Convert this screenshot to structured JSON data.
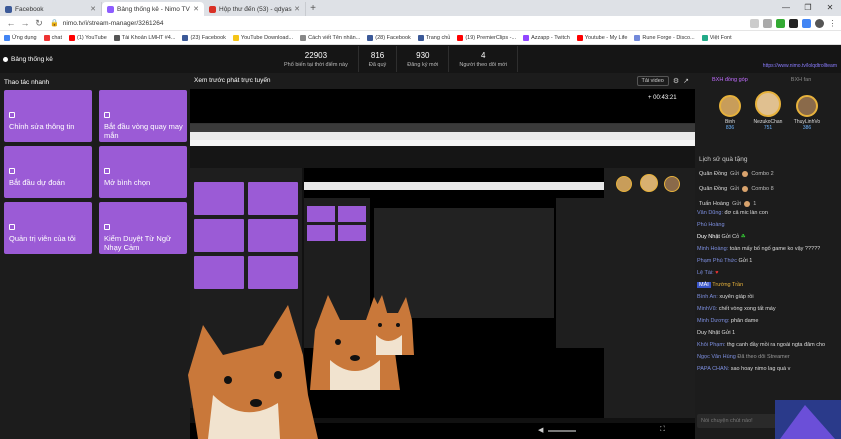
{
  "browser": {
    "tabs": [
      {
        "label": "Facebook",
        "color": "#3b5998",
        "active": false
      },
      {
        "label": "Bảng thống kê - Nimo TV",
        "color": "#8d5cff",
        "active": true
      },
      {
        "label": "Hộp thư đến (53) - qdyasus123...",
        "color": "#d93025",
        "active": false
      }
    ],
    "new_tab": "+",
    "url": "nimo.tv/i/stream-manager/3261264",
    "bookmarks": [
      "Ứng dụng",
      "chat",
      "(1) YouTube",
      "Tài Khoản LMHT #4...",
      "(23) Facebook",
      "YouTube Download...",
      "Cách viết Tên nhân...",
      "(28) Facebook",
      "Trang chủ",
      "(19) PremierClips -...",
      "Azzapp - Twitch",
      "Youtube - My Life",
      "Rune Forge - Disco...",
      "Việt Font"
    ]
  },
  "header": {
    "title": "Bảng thống kê",
    "stats": [
      {
        "value": "22903",
        "label": "Phổ biến tại thời điểm này"
      },
      {
        "value": "816",
        "label": "Đã quý"
      },
      {
        "value": "930",
        "label": "Đăng ký mới"
      },
      {
        "value": "4",
        "label": "Người theo dõi mới"
      }
    ],
    "link": "https://www.nimo.tv/lolqdtrollteam"
  },
  "left": {
    "heading": "Thao tác nhanh",
    "tiles": [
      "Chỉnh sửa thông tin",
      "Bắt đầu vòng quay may mắn",
      "Bắt đầu dự đoán",
      "Mở bình chọn",
      "Quản trị viên của tôi",
      "Kiểm Duyệt Từ Ngữ Nhạy Cảm"
    ]
  },
  "preview": {
    "heading": "Xem trước phát trực tuyến",
    "button": "Tải video",
    "timer": "+ 00:43:21"
  },
  "right": {
    "tab_active": "BXH đồng góp",
    "tab_other": "BXH fan",
    "ranks": [
      {
        "name": "Binh",
        "score": "836"
      },
      {
        "name": "NezukoChan",
        "score": "751"
      },
      {
        "name": "ThuyLinhVo",
        "score": "386"
      }
    ],
    "gift_heading": "Lịch sử quà tặng",
    "gifts": [
      {
        "name": "Quân Đồng",
        "verb": "Gửi",
        "combo": "Combo 2"
      },
      {
        "name": "Quân Đồng",
        "verb": "Gửi",
        "combo": "Combo 8"
      },
      {
        "name": "Tuấn Hoàng",
        "verb": "Gửi",
        "combo": "1"
      }
    ],
    "chat": [
      {
        "user": "Văn Dũng:",
        "text": "đơ cả mic làn con"
      },
      {
        "user": "Phú Hoàng",
        "text": ""
      },
      {
        "user": "Duy Nhật",
        "text": "Gửi Cỏ"
      },
      {
        "user": "Minh Hoàng:",
        "text": "toàn mấy bố ngố game ko vậy ?????"
      },
      {
        "user": "Phạm Phú Thức",
        "text": "Gửi 1"
      },
      {
        "user": "Lệ Tài:",
        "text": ""
      },
      {
        "user": "MÀI",
        "text": "Trường Trần"
      },
      {
        "user": "Bình An:",
        "text": "xuyên giáp rồi"
      },
      {
        "user": "MinhVũ:",
        "text": "chết vòng xong tất máy"
      },
      {
        "user": "Minh Dương:",
        "text": "phân dame"
      },
      {
        "user": "Duy Nhật",
        "text": "Gửi 1"
      },
      {
        "user": "Khôi Phạm:",
        "text": "thg canh đầy mồi ra ngoài ngta đâm cho"
      },
      {
        "user": "Ngọc Văn Hùng",
        "text": "Đã theo dõi Streamer"
      },
      {
        "user": "PAPA CHAN:",
        "text": "sao hoay nimo lag quá v"
      }
    ],
    "chat_placeholder": "Nói chuyện chút nào!"
  }
}
